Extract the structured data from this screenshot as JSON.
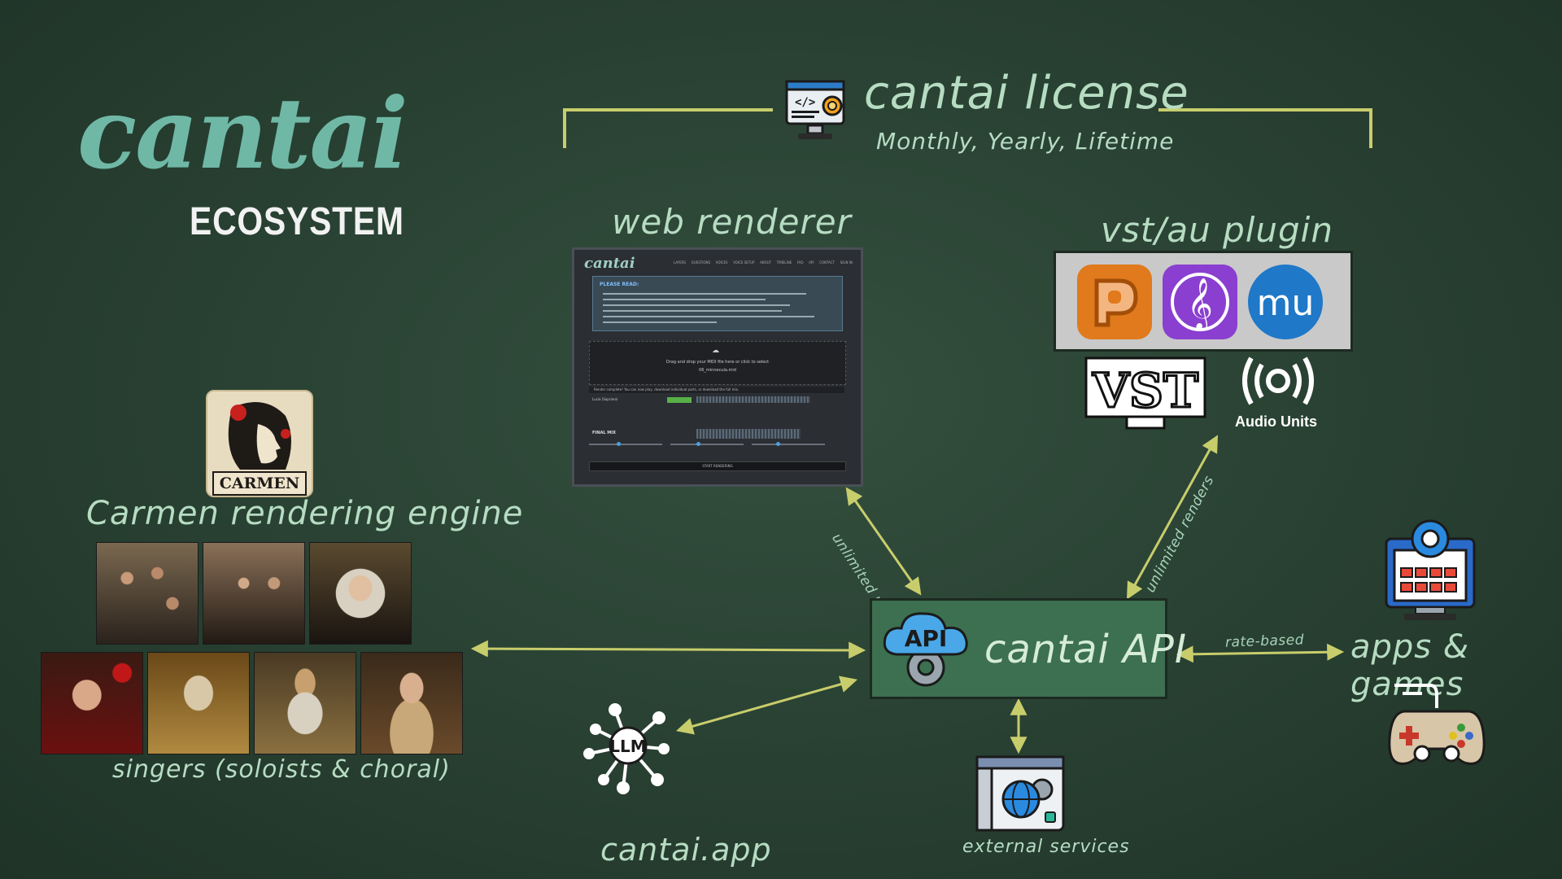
{
  "logo": {
    "word": "cantai",
    "subtitle": "ECOSYSTEM"
  },
  "license": {
    "title": "cantai license",
    "subtitle": "Monthly, Yearly, Lifetime",
    "icon": "certificate-monitor-icon"
  },
  "web_renderer": {
    "title": "web renderer",
    "screenshot": {
      "logo": "cantai",
      "nav": [
        "LAYERS",
        "QUESTIONS",
        "VOICES",
        "VOICE SETUP",
        "ABOUT",
        "TIMELINE",
        "FAQ",
        "API",
        "CONTACT",
        "SIGN IN"
      ],
      "notice_title": "PLEASE READ:",
      "dropzone_text": "Drag and drop your MIDI file here or click to select",
      "dropzone_file": "06_minnecula.mid",
      "status_text": "Render complete! You can now play, download individual parts, or download the full mix.",
      "track_label": "Lucia (Soprano)",
      "final_label": "FINAL MIX",
      "button_text": "START RENDERING"
    }
  },
  "plugin": {
    "title": "vst/au plugin",
    "icons": [
      {
        "name": "pro-tools-daw-icon",
        "color": "#e07a1c"
      },
      {
        "name": "treble-clef-app-icon",
        "color": "#8a3fd0"
      },
      {
        "name": "musescore-icon",
        "color": "#1f78c8"
      }
    ],
    "vst_text": "VST",
    "au_text": "Audio Units"
  },
  "carmen": {
    "badge_text": "CARMEN",
    "title": "Carmen rendering engine"
  },
  "singers": {
    "label": "singers (soloists & choral)",
    "tiles": [
      "choir-portrait",
      "choir-portrait",
      "veiled-woman-portrait",
      "flower-woman-portrait",
      "jester-portrait",
      "old-king-portrait",
      "gentleman-portrait"
    ]
  },
  "api": {
    "title": "cantai API",
    "badge": "API"
  },
  "llm": {
    "badge": "LLM",
    "label": "cantai.app"
  },
  "external": {
    "label": "external services"
  },
  "apps": {
    "label": "apps & games"
  },
  "arrows": {
    "web_link": "unlimited renders",
    "plugin_link": "unlimited renders",
    "apps_link": "rate-based"
  },
  "colors": {
    "accent": "#c8cd6c",
    "logo": "#6fb8a6",
    "api_box": "#3c7050",
    "label": "#b6dcc2"
  }
}
